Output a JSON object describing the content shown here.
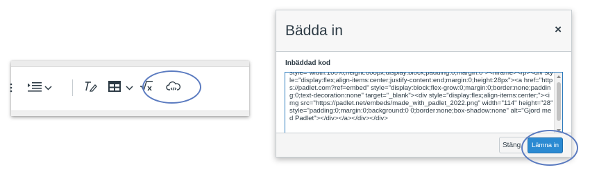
{
  "toolbar": {
    "icons": [
      "list-menu-icon",
      "indent-icon",
      "chevron-down-icon",
      "clear-formatting-icon",
      "table-icon",
      "chevron-down-icon",
      "math-equation-icon",
      "cloud-embed-icon"
    ],
    "highlight_color": "#5b7bc0"
  },
  "dialog": {
    "title": "Bädda in",
    "close_glyph": "×",
    "field_label": "Inbäddad kod",
    "code_value": "style=\"width:100%;height:608px;display:block;padding:0;margin:0\"></iframe></p><div style=\"display:flex;align-items:center;justify-content:end;margin:0;height:28px\"><a href=\"https://padlet.com?ref=embed\" style=\"display:block;flex-grow:0;margin:0;border:none;padding:0;text-decoration:none\" target=\"_blank\"><div style=\"display:flex;align-items:center;\"><img src=\"https://padlet.net/embeds/made_with_padlet_2022.png\" width=\"114\" height=\"28\" style=\"padding:0;margin:0;background:0 0;border:none;box-shadow:none\" alt=\"Gjord med Padlet\"></div></a></div></div>",
    "cancel_label": "Stäng",
    "submit_label": "Lämna in",
    "accent_color": "#2b8ad2"
  }
}
